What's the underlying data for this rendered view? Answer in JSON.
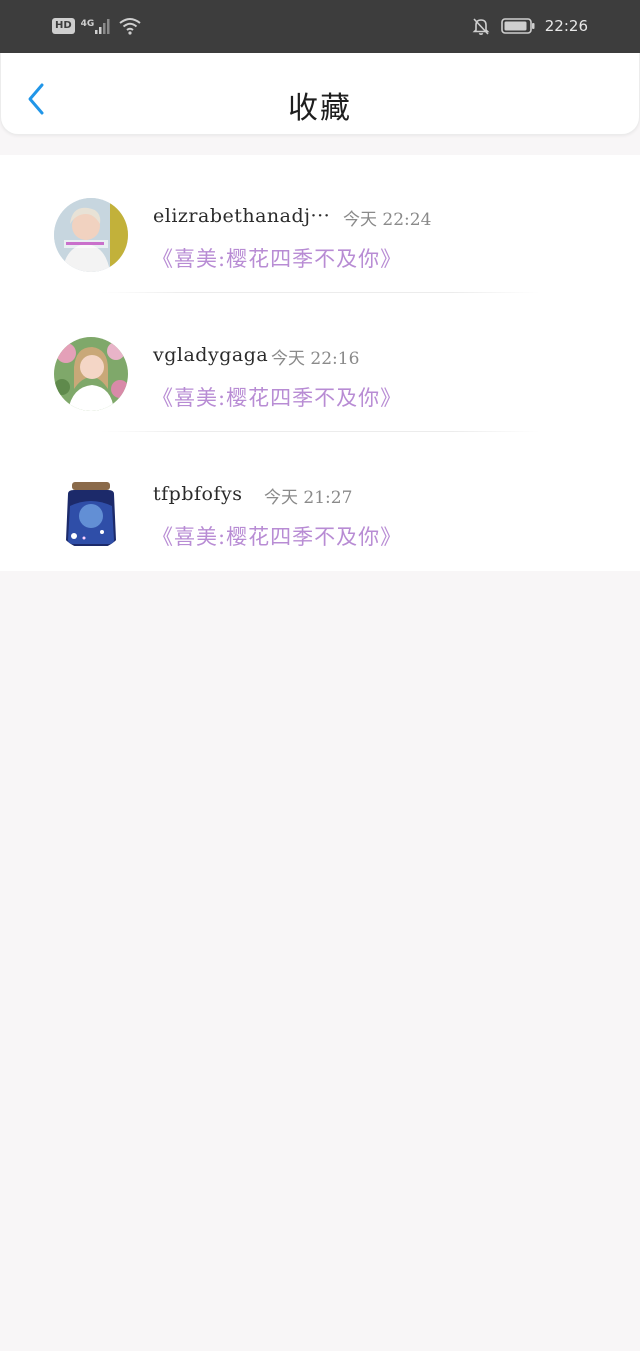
{
  "status_bar": {
    "hd": "HD",
    "network": "4G",
    "time": "22:26"
  },
  "header": {
    "title": "收藏",
    "back_icon": "chevron-left-icon",
    "accent_color": "#2196e8"
  },
  "favorites": [
    {
      "username": "elizrabethanadj···",
      "time": "今天 22:24",
      "snippet": "《喜美:樱花四季不及你》"
    },
    {
      "username": "vgladygaga",
      "time": "今天 22:16",
      "snippet": "《喜美:樱花四季不及你》"
    },
    {
      "username": "tfpbfofys",
      "time": "今天 21:27",
      "snippet": "《喜美:樱花四季不及你》"
    }
  ],
  "colors": {
    "snippet": "#b88cd4",
    "status_bar_bg": "#3d3d3d",
    "page_bg": "#f8f6f7"
  }
}
